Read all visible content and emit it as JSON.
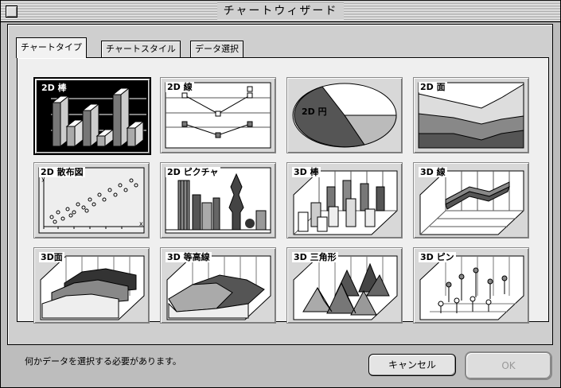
{
  "window": {
    "title": "チャートウィザード"
  },
  "tabs": [
    {
      "label": "チャートタイプ",
      "active": true
    },
    {
      "label": "チャートスタイル",
      "active": false
    },
    {
      "label": "データ選択",
      "active": false
    }
  ],
  "chart_types": [
    {
      "label": "2D 棒",
      "icon": "2d-bar-chart-icon",
      "selected": true
    },
    {
      "label": "2D 線",
      "icon": "2d-line-chart-icon",
      "selected": false
    },
    {
      "label": "2D 円",
      "icon": "2d-pie-chart-icon",
      "selected": false
    },
    {
      "label": "2D 面",
      "icon": "2d-area-chart-icon",
      "selected": false
    },
    {
      "label": "2D 散布図",
      "icon": "2d-scatter-chart-icon",
      "selected": false
    },
    {
      "label": "2D ピクチャ",
      "icon": "2d-picture-chart-icon",
      "selected": false
    },
    {
      "label": "3D 棒",
      "icon": "3d-bar-chart-icon",
      "selected": false
    },
    {
      "label": "3D 線",
      "icon": "3d-line-chart-icon",
      "selected": false
    },
    {
      "label": "3D面",
      "icon": "3d-area-chart-icon",
      "selected": false
    },
    {
      "label": "3D 等高線",
      "icon": "3d-contour-chart-icon",
      "selected": false
    },
    {
      "label": "3D 三角形",
      "icon": "3d-triangle-chart-icon",
      "selected": false
    },
    {
      "label": "3D ピン",
      "icon": "3d-pin-chart-icon",
      "selected": false
    }
  ],
  "icon_text": {
    "scatter_y": "y",
    "scatter_x": "x"
  },
  "status_message": "何かデータを選択する必要があります。",
  "buttons": {
    "cancel": "キャンセル",
    "ok": "OK"
  }
}
